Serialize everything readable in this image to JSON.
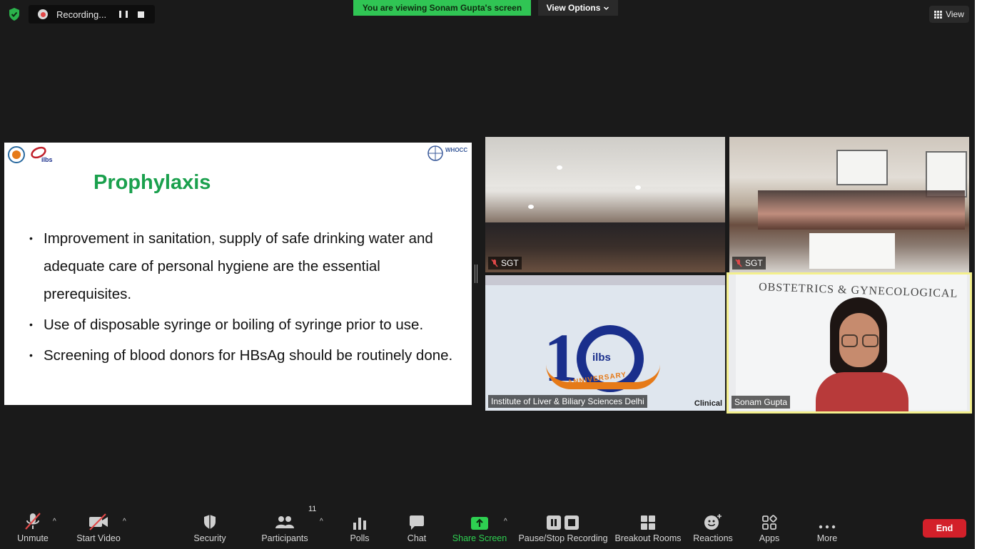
{
  "topbar": {
    "recording_label": "Recording...",
    "viewing_banner": "You are viewing Sonam Gupta's screen",
    "view_options_label": "View Options",
    "view_label": "View"
  },
  "slide": {
    "title": "Prophylaxis",
    "logo_right_text": "WHOCC",
    "bullets": [
      "Improvement in sanitation, supply of safe drinking water and adequate care of personal  hygiene are the essential prerequisites.",
      "Use of disposable syringe or boiling of syringe prior to use.",
      "Screening of blood donors for HBsAg should be routinely done."
    ]
  },
  "tiles": [
    {
      "name": "SGT"
    },
    {
      "name": "SGT"
    },
    {
      "name": "Institute of Liver & Biliary Sciences  Delhi",
      "banner_text": "Clinical"
    },
    {
      "name": "Sonam Gupta",
      "board_text": "OBSTETRICS & GYNECOLOGICAL"
    }
  ],
  "toolbar": {
    "unmute": "Unmute",
    "start_video": "Start Video",
    "security": "Security",
    "participants": "Participants",
    "participants_count": "11",
    "polls": "Polls",
    "chat": "Chat",
    "share_screen": "Share Screen",
    "pause_stop_recording": "Pause/Stop Recording",
    "breakout_rooms": "Breakout Rooms",
    "reactions": "Reactions",
    "apps": "Apps",
    "more": "More",
    "end": "End"
  },
  "colors": {
    "accent_green": "#30c554",
    "end_red": "#d3202a",
    "active_speaker": "#f3ef8c",
    "slide_title_green": "#1aa04d"
  }
}
